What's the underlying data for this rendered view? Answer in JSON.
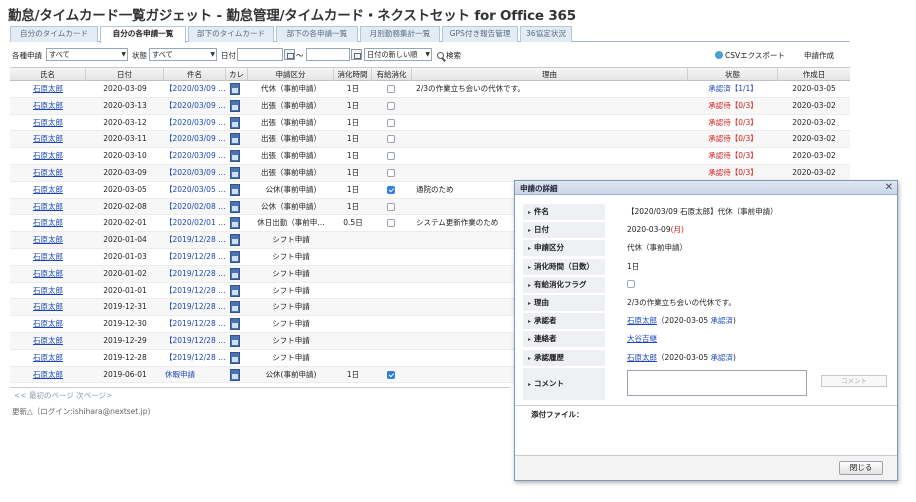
{
  "title": "勤怠/タイムカード一覧ガジェット - 勤怠管理/タイムカード・ネクストセット for Office 365",
  "tabs": [
    {
      "label": "自分のタイムカード"
    },
    {
      "label": "自分の各申請一覧"
    },
    {
      "label": "部下のタイムカード"
    },
    {
      "label": "部下の各申請一覧"
    },
    {
      "label": "月別勤務集計一覧"
    },
    {
      "label": "GPS付き報告管理"
    },
    {
      "label": "36協定状況"
    }
  ],
  "filters": {
    "type_label": "各種申請",
    "type_value": "すべて",
    "state_label": "状態",
    "state_value": "すべて",
    "date_label": "日付",
    "range_sep": "〜",
    "sort_value": "日付の新しい順",
    "search_label": "検索",
    "csv_label": "CSVエクスポート",
    "create_label": "申請作成"
  },
  "columns": {
    "name": "氏名",
    "date": "日付",
    "item": "件名",
    "cal": "カレ",
    "kubun": "申請区分",
    "time": "消化時間",
    "flag": "有給消化",
    "reason": "理由",
    "status": "状態",
    "created": "作成日"
  },
  "rows": [
    {
      "name": "石原太郎",
      "date": "2020-03-09",
      "item": "【2020/03/09 …",
      "kubun": "代休（事前申請）",
      "time": "1日",
      "checked": false,
      "reason": "2/3の作業立ち会いの代休です。",
      "status": "承認済【1/1】",
      "status_type": "done",
      "created": "2020-03-05"
    },
    {
      "name": "石原太郎",
      "date": "2020-03-13",
      "item": "【2020/03/09 …",
      "kubun": "出張（事前申請）",
      "time": "1日",
      "checked": false,
      "reason": "",
      "status": "承認待【0/3】",
      "status_type": "wait",
      "created": "2020-03-02"
    },
    {
      "name": "石原太郎",
      "date": "2020-03-12",
      "item": "【2020/03/09 …",
      "kubun": "出張（事前申請）",
      "time": "1日",
      "checked": false,
      "reason": "",
      "status": "承認待【0/3】",
      "status_type": "wait",
      "created": "2020-03-02"
    },
    {
      "name": "石原太郎",
      "date": "2020-03-11",
      "item": "【2020/03/09 …",
      "kubun": "出張（事前申請）",
      "time": "1日",
      "checked": false,
      "reason": "",
      "status": "承認待【0/3】",
      "status_type": "wait",
      "created": "2020-03-02"
    },
    {
      "name": "石原太郎",
      "date": "2020-03-10",
      "item": "【2020/03/09 …",
      "kubun": "出張（事前申請）",
      "time": "1日",
      "checked": false,
      "reason": "",
      "status": "承認待【0/3】",
      "status_type": "wait",
      "created": "2020-03-02"
    },
    {
      "name": "石原太郎",
      "date": "2020-03-09",
      "item": "【2020/03/09 …",
      "kubun": "出張（事前申請）",
      "time": "1日",
      "checked": false,
      "reason": "",
      "status": "承認待【0/3】",
      "status_type": "wait",
      "created": "2020-03-02"
    },
    {
      "name": "石原太郎",
      "date": "2020-03-05",
      "item": "【2020/03/05 …",
      "kubun": "公休(事前申請)",
      "time": "1日",
      "checked": true,
      "reason": "通院のため",
      "status": "",
      "status_type": "",
      "created": ""
    },
    {
      "name": "石原太郎",
      "date": "2020-02-08",
      "item": "【2020/02/08 …",
      "kubun": "公休（事前申請）",
      "time": "1日",
      "checked": false,
      "reason": "",
      "status": "",
      "status_type": "",
      "created": ""
    },
    {
      "name": "石原太郎",
      "date": "2020-02-01",
      "item": "【2020/02/01 …",
      "kubun": "休日出勤（事前申…",
      "time": "0.5日",
      "checked": false,
      "reason": "システム更新作業のため",
      "status": "",
      "status_type": "",
      "created": ""
    },
    {
      "name": "石原太郎",
      "date": "2020-01-04",
      "item": "【2019/12/28 …",
      "kubun": "シフト申請",
      "time": "",
      "checked": null,
      "reason": "",
      "status": "",
      "status_type": "",
      "created": ""
    },
    {
      "name": "石原太郎",
      "date": "2020-01-03",
      "item": "【2019/12/28 …",
      "kubun": "シフト申請",
      "time": "",
      "checked": null,
      "reason": "",
      "status": "",
      "status_type": "",
      "created": ""
    },
    {
      "name": "石原太郎",
      "date": "2020-01-02",
      "item": "【2019/12/28 …",
      "kubun": "シフト申請",
      "time": "",
      "checked": null,
      "reason": "",
      "status": "",
      "status_type": "",
      "created": ""
    },
    {
      "name": "石原太郎",
      "date": "2020-01-01",
      "item": "【2019/12/28 …",
      "kubun": "シフト申請",
      "time": "",
      "checked": null,
      "reason": "",
      "status": "",
      "status_type": "",
      "created": ""
    },
    {
      "name": "石原太郎",
      "date": "2019-12-31",
      "item": "【2019/12/28 …",
      "kubun": "シフト申請",
      "time": "",
      "checked": null,
      "reason": "",
      "status": "",
      "status_type": "",
      "created": ""
    },
    {
      "name": "石原太郎",
      "date": "2019-12-30",
      "item": "【2019/12/28 …",
      "kubun": "シフト申請",
      "time": "",
      "checked": null,
      "reason": "",
      "status": "",
      "status_type": "",
      "created": ""
    },
    {
      "name": "石原太郎",
      "date": "2019-12-29",
      "item": "【2019/12/28 …",
      "kubun": "シフト申請",
      "time": "",
      "checked": null,
      "reason": "",
      "status": "",
      "status_type": "",
      "created": ""
    },
    {
      "name": "石原太郎",
      "date": "2019-12-28",
      "item": "【2019/12/28 …",
      "kubun": "シフト申請",
      "time": "",
      "checked": null,
      "reason": "",
      "status": "",
      "status_type": "",
      "created": ""
    },
    {
      "name": "石原太郎",
      "date": "2019-06-01",
      "item": "休暇申請",
      "kubun": "公休(事前申請)",
      "time": "1日",
      "checked": true,
      "reason": "",
      "status": "",
      "status_type": "",
      "created": ""
    }
  ],
  "pager": "<< 最初のページ 次ページ>",
  "updated": "更新△（ログイン:ishihara@nextset.jp)",
  "dialog": {
    "title": "申請の詳細",
    "close_x": "✕",
    "fields": {
      "subject_label": "件名",
      "subject_value": "【2020/03/09 石原太郎】代休（事前申請）",
      "date_label": "日付",
      "date_value": "2020-03-09",
      "date_weekday": "(月)",
      "kubun_label": "申請区分",
      "kubun_value": "代休（事前申請）",
      "time_label": "消化時間（日数）",
      "time_value": "1日",
      "flag_label": "有給消化フラグ",
      "reason_label": "理由",
      "reason_value": "2/3の作業立ち会いの代休です。",
      "approver_label": "承認者",
      "approver_name": "石原太郎",
      "approver_detail": "（2020-03-05",
      "approver_status": "承認済",
      "approver_end": ")",
      "contact_label": "連絡者",
      "contact_name": "大谷吉継",
      "history_label": "承認履歴",
      "history_name": "石原太郎",
      "history_detail": "（2020-03-05",
      "history_status": "承認済",
      "history_end": ")",
      "comment_label": "コメント",
      "comment_button": "コメント",
      "attach_label": "添付ファイル："
    },
    "close_button": "閉じる"
  }
}
